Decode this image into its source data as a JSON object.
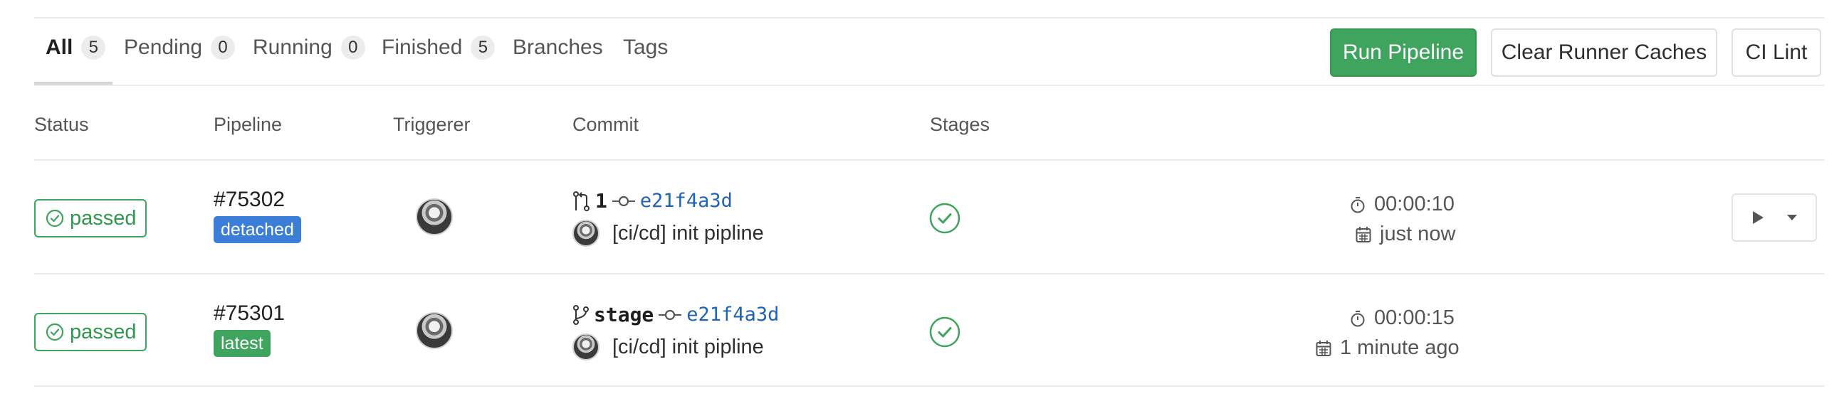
{
  "tabs": [
    {
      "label": "All",
      "count": "5"
    },
    {
      "label": "Pending",
      "count": "0"
    },
    {
      "label": "Running",
      "count": "0"
    },
    {
      "label": "Finished",
      "count": "5"
    },
    {
      "label": "Branches"
    },
    {
      "label": "Tags"
    }
  ],
  "toolbar": {
    "run_pipeline": "Run Pipeline",
    "clear_caches": "Clear Runner Caches",
    "ci_lint": "CI Lint"
  },
  "table": {
    "headers": {
      "status": "Status",
      "pipeline": "Pipeline",
      "triggerer": "Triggerer",
      "commit": "Commit",
      "stages": "Stages"
    },
    "rows": [
      {
        "status": "passed",
        "pipeline_id": "#75302",
        "pipeline_label": "detached",
        "ref_icon": "merge-request-icon",
        "ref_name": "1",
        "sha": "e21f4a3d",
        "message": "[ci/cd] init pipline",
        "stage_status": "success",
        "duration": "00:00:10",
        "finished": "just now"
      },
      {
        "status": "passed",
        "pipeline_id": "#75301",
        "pipeline_label": "latest",
        "ref_icon": "branch-icon",
        "ref_name": "stage",
        "sha": "e21f4a3d",
        "message": "[ci/cd] init pipline",
        "stage_status": "success",
        "duration": "00:00:15",
        "finished": "1 minute ago"
      }
    ]
  },
  "colors": {
    "success": "#3fa45d",
    "link": "#1f63b8",
    "detached_label": "#3a7ed8"
  }
}
